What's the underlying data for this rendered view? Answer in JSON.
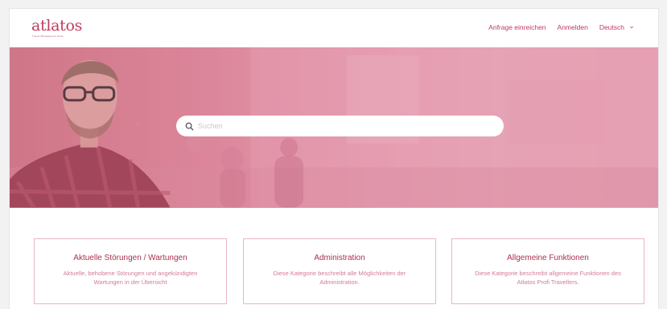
{
  "header": {
    "logo": "atlatos",
    "logo_tagline": "Travel Management Suite",
    "nav": {
      "submit_request": "Anfrage einreichen",
      "login": "Anmelden",
      "language": "Deutsch"
    }
  },
  "search": {
    "placeholder": "Suchen"
  },
  "cards": [
    {
      "title": "Aktuelle Störungen / Wartungen",
      "description": "Aktuelle, behobene Störungen und angekündigten Wartungen in der Übersicht"
    },
    {
      "title": "Administration",
      "description": "Diese Kategorie beschreibt alle Möglichkeiten der Administration."
    },
    {
      "title": "Allgemeine Funktionen",
      "description": "Diese Kategorie beschreibt allgemeine Funktionen des Atlatos Profi Travellers."
    }
  ],
  "colors": {
    "brand": "#c23a5e",
    "hero_overlay": "#e29ab0",
    "card_border": "#e7b7c4"
  },
  "icons": {
    "search": "search-icon",
    "language_dropdown": "chevron-down-icon"
  }
}
